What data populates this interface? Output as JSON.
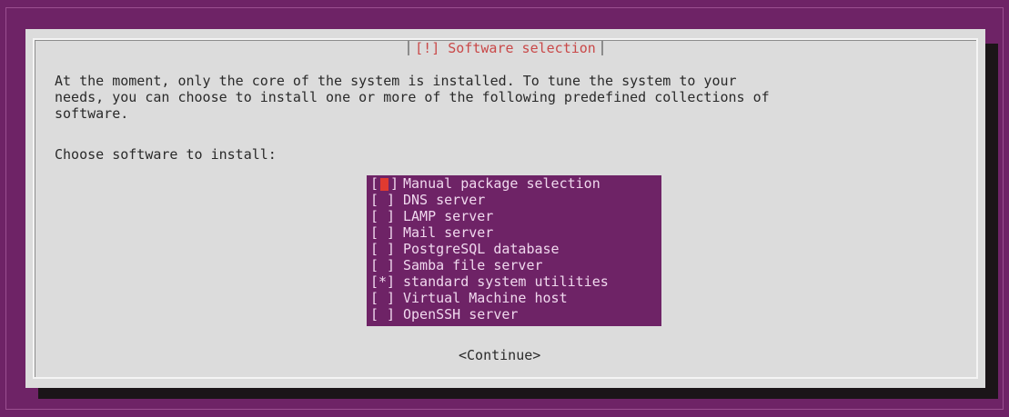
{
  "dialog": {
    "title": "[!] Software selection",
    "description": "At the moment, only the core of the system is installed. To tune the system to your\nneeds, you can choose to install one or more of the following predefined collections of\nsoftware.",
    "prompt": "Choose software to install:",
    "continue_label": "<Continue>"
  },
  "software": [
    {
      "box": "[ ]",
      "label": "Manual package selection"
    },
    {
      "box": "[ ]",
      "label": "DNS server"
    },
    {
      "box": "[ ]",
      "label": "LAMP server"
    },
    {
      "box": "[ ]",
      "label": "Mail server"
    },
    {
      "box": "[ ]",
      "label": "PostgreSQL database"
    },
    {
      "box": "[ ]",
      "label": "Samba file server"
    },
    {
      "box": "[*]",
      "label": "standard system utilities"
    },
    {
      "box": "[ ]",
      "label": "Virtual Machine host"
    },
    {
      "box": "[ ]",
      "label": "OpenSSH server"
    }
  ],
  "colors": {
    "background": "#6e2366",
    "dialog": "#dcdcdc",
    "title": "#c94848",
    "cursor": "#e03a30"
  }
}
